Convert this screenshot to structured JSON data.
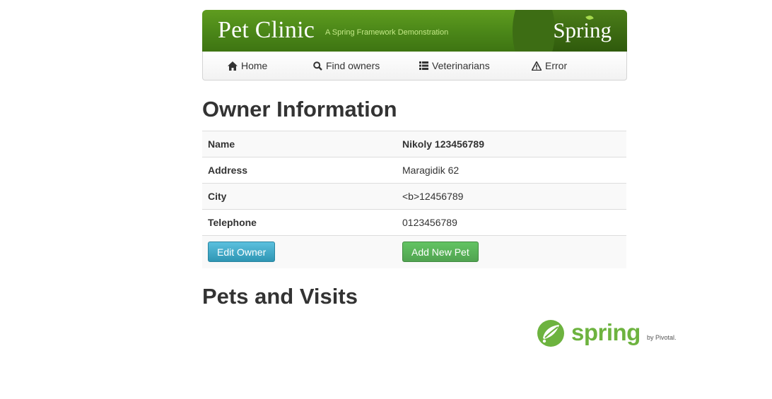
{
  "header": {
    "brand_title": "Pet Clinic",
    "brand_subtitle": "A Spring Framework Demonstration",
    "spring_logo_text": "Spring"
  },
  "nav": {
    "items": [
      {
        "label": "Home",
        "icon": "home-icon"
      },
      {
        "label": "Find owners",
        "icon": "search-icon"
      },
      {
        "label": "Veterinarians",
        "icon": "list-icon"
      },
      {
        "label": "Error",
        "icon": "warning-icon"
      }
    ]
  },
  "owner": {
    "heading": "Owner Information",
    "rows": [
      {
        "label": "Name",
        "value": "Nikoly 123456789"
      },
      {
        "label": "Address",
        "value": "Maragidik 62"
      },
      {
        "label": "City",
        "value": "<b>12456789"
      },
      {
        "label": "Telephone",
        "value": "0123456789"
      }
    ],
    "edit_button": "Edit Owner",
    "add_pet_button": "Add New Pet"
  },
  "pets": {
    "heading": "Pets and Visits"
  },
  "footer": {
    "logo_text": "spring",
    "by_text": "by Pivotal."
  },
  "colors": {
    "banner_green": "#4a8618",
    "button_info": "#2f96b4",
    "button_success": "#51a351",
    "spring_green": "#6db33f"
  }
}
